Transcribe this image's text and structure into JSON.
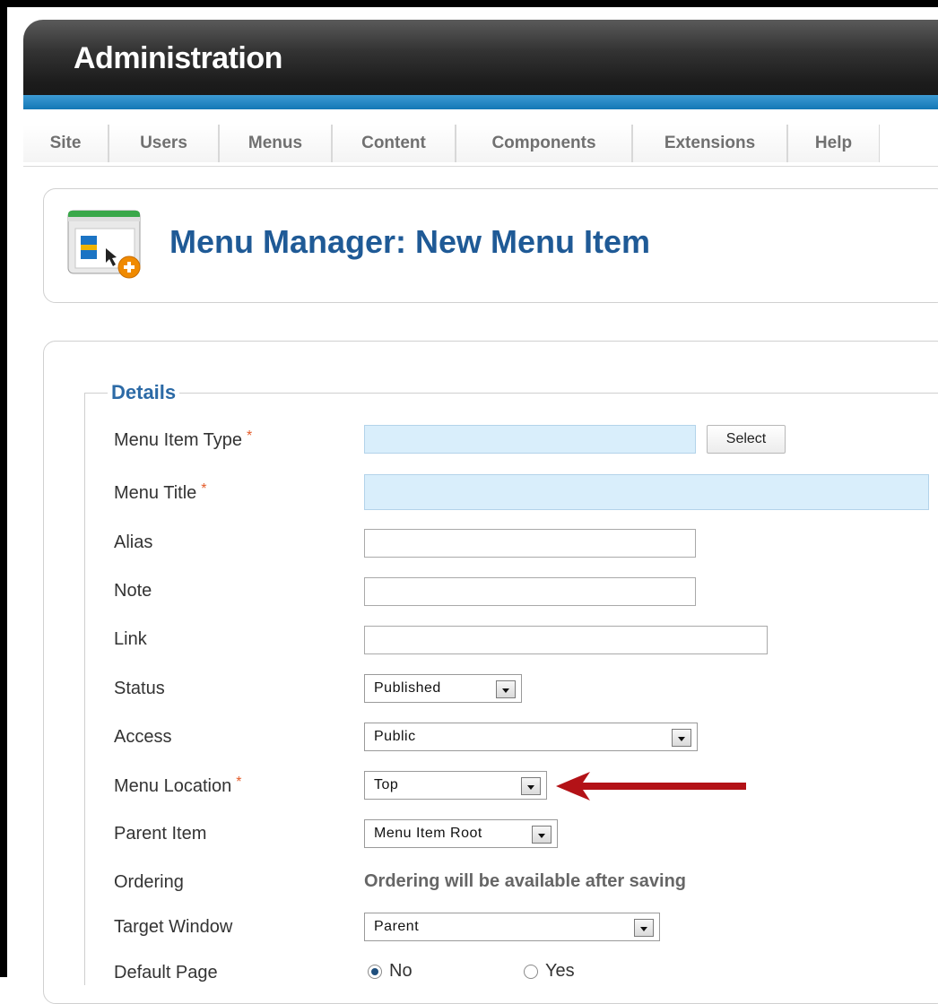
{
  "header": {
    "title": "Administration"
  },
  "menu": [
    "Site",
    "Users",
    "Menus",
    "Content",
    "Components",
    "Extensions",
    "Help"
  ],
  "page": {
    "title": "Menu Manager: New Menu Item",
    "icon": "menu-add-icon"
  },
  "details": {
    "legend": "Details",
    "menu_item_type": {
      "label": "Menu Item Type",
      "required": "*",
      "value": "",
      "button": "Select"
    },
    "menu_title": {
      "label": "Menu Title",
      "required": "*",
      "value": ""
    },
    "alias": {
      "label": "Alias",
      "value": ""
    },
    "note": {
      "label": "Note",
      "value": ""
    },
    "link": {
      "label": "Link",
      "value": ""
    },
    "status": {
      "label": "Status",
      "value": "Published"
    },
    "access": {
      "label": "Access",
      "value": "Public"
    },
    "menu_location": {
      "label": "Menu Location",
      "required": "*",
      "value": "Top"
    },
    "parent_item": {
      "label": "Parent Item",
      "value": "Menu Item Root"
    },
    "ordering": {
      "label": "Ordering",
      "value": "Ordering will be available after saving"
    },
    "target_window": {
      "label": "Target Window",
      "value": "Parent"
    },
    "default_page": {
      "label": "Default Page",
      "options": [
        "No",
        "Yes"
      ],
      "selected": "No"
    }
  },
  "colors": {
    "header_blue": "#1377b5",
    "title_blue": "#1f5a96",
    "required_field": "#d9eefb",
    "arrow_red": "#b31217"
  }
}
